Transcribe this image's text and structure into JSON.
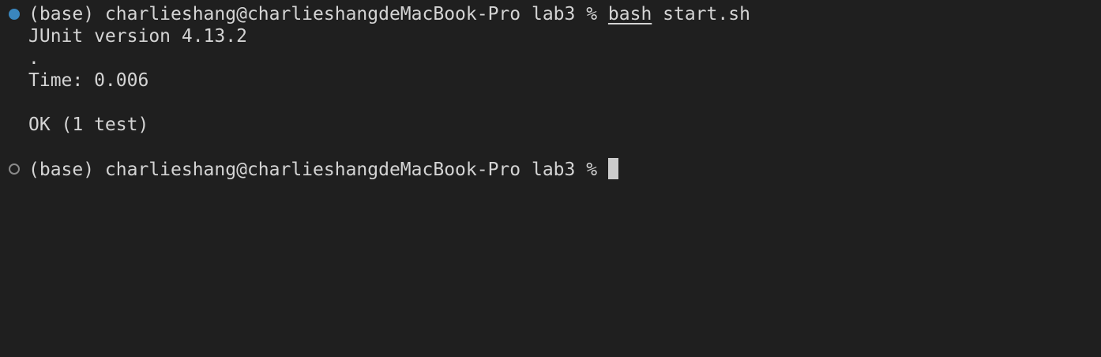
{
  "terminal": {
    "prompt_1": "(base) charlieshang@charlieshangdeMacBook-Pro lab3 % ",
    "command_1_name": "bash",
    "command_1_args": " start.sh",
    "output": {
      "junit_version": "JUnit version 4.13.2",
      "progress": ".",
      "time": "Time: 0.006",
      "result": "OK (1 test)"
    },
    "prompt_2": "(base) charlieshang@charlieshangdeMacBook-Pro lab3 % ",
    "decoration_colors": {
      "success": "#3a86be",
      "pending": "#8a8a8a"
    },
    "background_color": "#1f1f1f",
    "text_color": "#d4d4d4"
  }
}
